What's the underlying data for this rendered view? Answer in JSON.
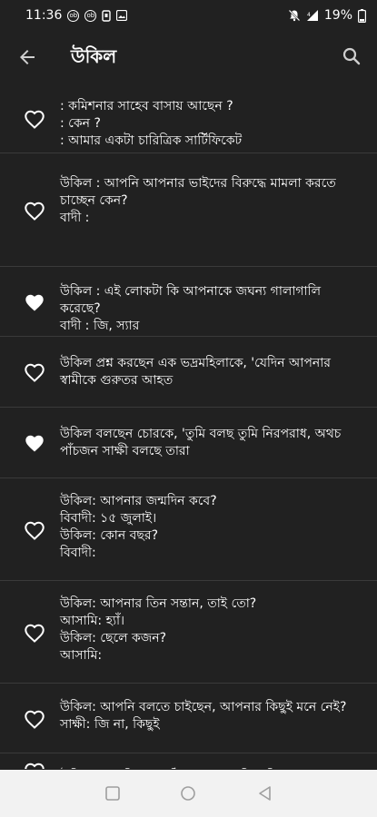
{
  "status": {
    "time": "11:36",
    "battery": "19%",
    "left_icons": [
      "ob-icon",
      "ob-icon",
      "sim-icon",
      "image-icon"
    ],
    "right_icons": [
      "mute-icon",
      "signal-icon",
      "battery-icon"
    ]
  },
  "appbar": {
    "title": "উকিল"
  },
  "items": [
    {
      "liked": false,
      "text": ": কমিশনার সাহেব বাসায় আছেন ?\n: কেন ?\n: আমার একটা চারিত্রিক সার্টিফিকেট"
    },
    {
      "liked": false,
      "text": "উকিল : আপনি আপনার ভাইদের বিরুদ্ধে মামলা করতে চাচ্ছেন কেন?\nবাদী :"
    },
    {
      "liked": true,
      "text": "উকিল : এই লোকটা কি আপনাকে জঘন্য গালাগালি করেছে?\nবাদী : জি, স্যার"
    },
    {
      "liked": false,
      "text": "উকিল প্রশ্ন করছেন এক ভদ্রমহিলাকে, 'যেদিন আপনার স্বামীকে গুরুতর আহত"
    },
    {
      "liked": true,
      "text": "উকিল বলছেন চোরকে, 'তুমি বলছ তুমি নিরপরাধ, অথচ পাঁচজন সাক্ষী বলছে তারা"
    },
    {
      "liked": false,
      "text": "উকিল: আপনার জন্মদিন কবে?\nবিবাদী: ১৫ জুলাই।\nউকিল: কোন বছর?\nবিবাদী:"
    },
    {
      "liked": false,
      "text": "উকিল: আপনার তিন সন্তান, তাই তো?\nআসামি: হ্যাঁ।\nউকিল: ছেলে কজন?\nআসামি:"
    },
    {
      "liked": false,
      "text": "উকিল: আপনি বলতে চাইছেন, আপনার কিছুই মনে নেই?\nসাক্ষী: জি না, কিছুই"
    },
    {
      "liked": false,
      "text": "উকিল: আপনি মামলাটিতে কোথায় ছিলেছিলেন?"
    }
  ]
}
